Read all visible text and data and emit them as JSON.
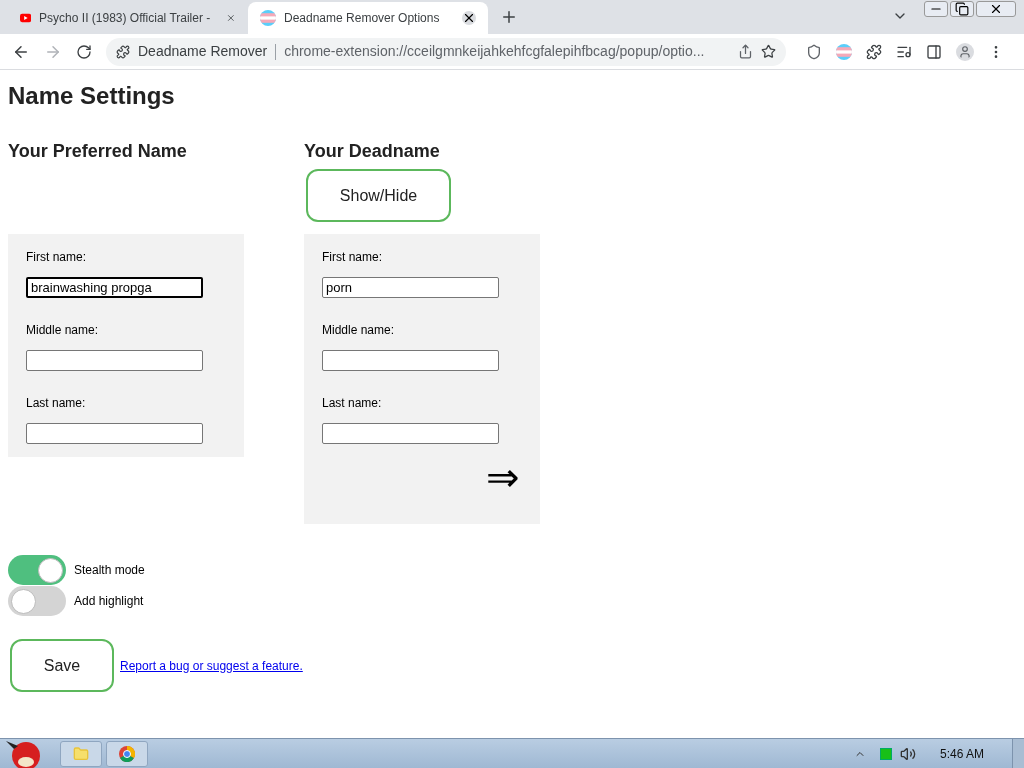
{
  "browser": {
    "tabs": [
      {
        "title": "Psycho II (1983) Official Trailer -",
        "kind": "video",
        "selected": false
      },
      {
        "title": "Deadname Remover Options",
        "kind": "flag",
        "selected": true
      }
    ],
    "site_label": "Deadname Remover",
    "url": "chrome-extension://cceilgmnkeijahkehfcgfalepihfbcag/popup/optio..."
  },
  "page": {
    "title": "Name Settings",
    "preferred": {
      "heading": "Your Preferred Name",
      "fields": [
        {
          "label": "First name:",
          "value": "brainwashing propga",
          "focused": true
        },
        {
          "label": "Middle name:",
          "focused": false
        },
        {
          "label": "Last name:",
          "focused": false
        }
      ]
    },
    "deadname": {
      "heading": "Your Deadname",
      "show_hide": "Show/Hide",
      "arrow": "⇒",
      "fields": [
        {
          "label": "First name:",
          "value": "porn",
          "focused": false
        },
        {
          "label": "Middle name:",
          "focused": false
        },
        {
          "label": "Last name:",
          "focused": false
        }
      ]
    },
    "toggles": [
      {
        "label": "Stealth mode",
        "on": true
      },
      {
        "label": "Add highlight",
        "on": false
      }
    ],
    "save": "Save",
    "link": "Report a bug or suggest a feature."
  },
  "taskbar": {
    "time": "5:46 AM"
  }
}
